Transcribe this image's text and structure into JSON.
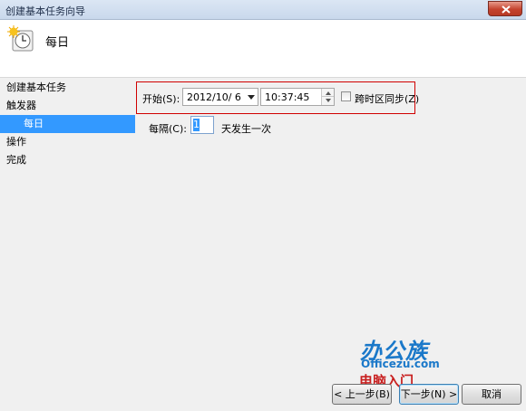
{
  "window": {
    "title": "创建基本任务向导"
  },
  "header": {
    "heading": "每日"
  },
  "sidebar": {
    "steps": [
      {
        "label": "创建基本任务"
      },
      {
        "label": "触发器"
      },
      {
        "label": "每日"
      },
      {
        "label": "操作"
      },
      {
        "label": "完成"
      }
    ],
    "active_step": "每日"
  },
  "trigger": {
    "start_label": "开始(S):",
    "start_date": "2012/10/  6",
    "start_time": "10:37:45",
    "sync_label": "跨时区同步(Z)",
    "sync_checked": false,
    "recur_label": "每隔(C):",
    "recur_value": "1",
    "recur_suffix": "天发生一次"
  },
  "watermark": {
    "brand": "办公族",
    "site": "Officezu.com",
    "subtitle": "电脑入门"
  },
  "buttons": {
    "back": "< 上一步(B)",
    "next": "下一步(N) >",
    "cancel": "取消"
  }
}
